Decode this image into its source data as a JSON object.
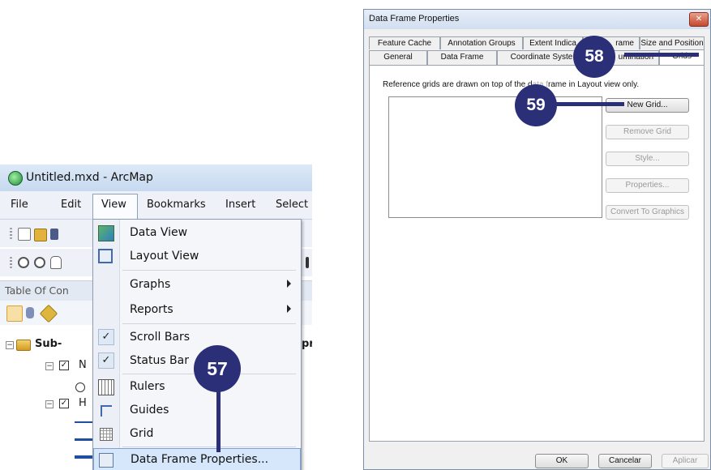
{
  "arcmap": {
    "title": "Untitled.mxd - ArcMap",
    "menubar": [
      "File",
      "Edit",
      "View",
      "Bookmarks",
      "Insert",
      "Select"
    ],
    "toc_title": "Table Of Con",
    "toc": {
      "root_label": "Sub-",
      "layer1_label": "N",
      "layer2_label": "H",
      "clipped_right": "pr"
    },
    "view_menu": {
      "items": [
        {
          "label": "Data View",
          "icon": "data-view-icon"
        },
        {
          "label": "Layout View",
          "icon": "layout-view-icon"
        },
        {
          "label": "Graphs",
          "submenu": true
        },
        {
          "label": "Reports",
          "submenu": true
        },
        {
          "label": "Scroll Bars",
          "checked": true
        },
        {
          "label": "Status Bar",
          "checked": true
        },
        {
          "label": "Rulers",
          "icon": "rulers-icon"
        },
        {
          "label": "Guides",
          "icon": "guides-icon"
        },
        {
          "label": "Grid",
          "icon": "grid-icon"
        },
        {
          "label": "Data Frame Properties...",
          "icon": "data-frame-properties-icon",
          "highlighted": true
        }
      ]
    }
  },
  "dialog": {
    "title": "Data Frame Properties",
    "close_glyph": "✕",
    "tabs_row1": [
      "Feature Cache",
      "Annotation Groups",
      "Extent Indica",
      "rame",
      "Size and Position"
    ],
    "tabs_row2": [
      "General",
      "Data Frame",
      "Coordinate Syste",
      "umination",
      "Grids"
    ],
    "selected_tab": "Grids",
    "description": "Reference grids are drawn on top of the d",
    "description_tail": "rame in Layout view only.",
    "buttons": {
      "new_grid": "New Grid...",
      "remove_grid": "Remove Grid",
      "style": "Style...",
      "properties": "Properties...",
      "convert": "Convert To Graphics"
    },
    "footer": {
      "ok": "OK",
      "cancel": "Cancelar",
      "apply": "Aplicar"
    }
  },
  "callouts": {
    "c57": "57",
    "c58": "58",
    "c59": "59"
  },
  "colors": {
    "callout": "#2b2f78",
    "menu_highlight": "#d6e7fb"
  }
}
